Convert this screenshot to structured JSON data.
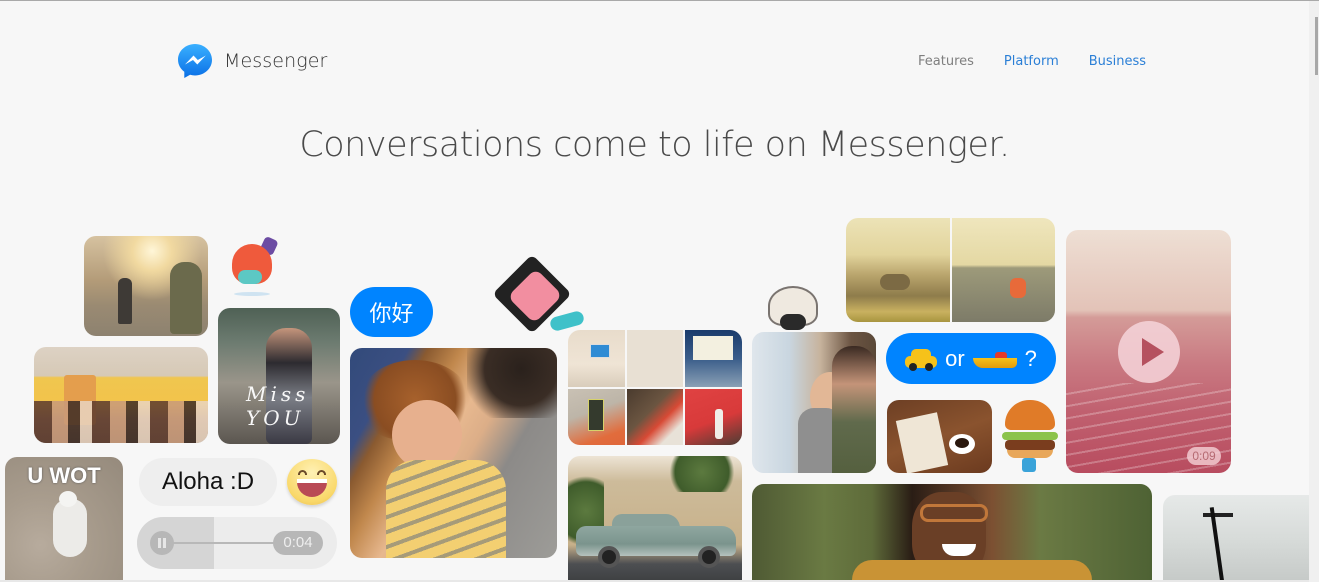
{
  "header": {
    "brand": "Messenger",
    "logo_icon": "messenger-bolt-icon",
    "nav": [
      {
        "label": "Features",
        "active": false
      },
      {
        "label": "Platform",
        "active": true
      },
      {
        "label": "Business",
        "active": true
      }
    ]
  },
  "hero": {
    "headline": "Conversations come to life on Messenger."
  },
  "collage": {
    "missyou_text": "Miss YOU",
    "meme_caption": "U WOT",
    "bubble_nihao": "你好",
    "bubble_aloha": "Aloha :D",
    "audio_time": "0:04",
    "bubble_or": {
      "before": "taxi-emoji",
      "word": "or",
      "after": "speedboat-emoji",
      "end": "?"
    },
    "video_time": "0:09",
    "stickers": [
      "dinosaur-sticker",
      "girl-laughing-sticker",
      "sheep-sticker",
      "burger-sticker",
      "laughing-emoji"
    ]
  },
  "colors": {
    "brand_blue": "#0084ff",
    "nav_link": "#2b7fd6",
    "nav_muted": "#7f7f7f",
    "background": "#f7f7f7"
  }
}
